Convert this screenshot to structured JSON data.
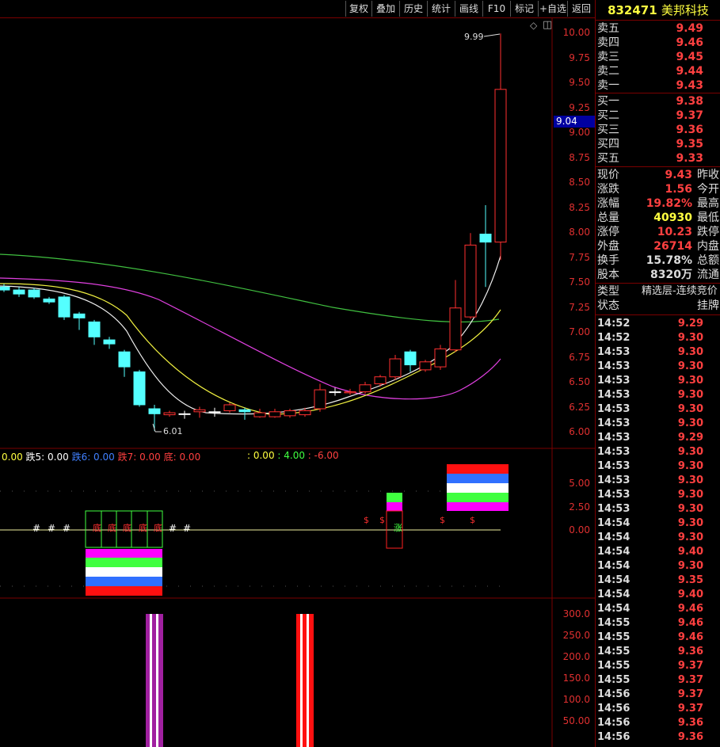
{
  "toolbar": {
    "buttons": [
      "复权",
      "叠加",
      "历史",
      "统计",
      "画线",
      "F10",
      "标记",
      "+自选",
      "返回"
    ]
  },
  "stock": {
    "code": "832471",
    "name": "美邦科技"
  },
  "main_chart": {
    "y_ticks": [
      "10.00",
      "9.75",
      "9.50",
      "9.25",
      "9.00",
      "8.75",
      "8.50",
      "8.25",
      "8.00",
      "7.75",
      "7.50",
      "7.25",
      "7.00",
      "6.75",
      "6.50",
      "6.25",
      "6.00"
    ],
    "high_label": "9.99",
    "low_label": "6.01",
    "cursor_price": "9.04",
    "markers": [
      "◇",
      "◫"
    ]
  },
  "indicator": {
    "labels": [
      {
        "text": "0.00",
        "color": "#ffff40"
      },
      {
        "text": " 跌5: 0.00",
        "color": "#ffffff"
      },
      {
        "text": " 跌6: 0.00",
        "color": "#4080ff"
      },
      {
        "text": " 跌7: 0.00",
        "color": "#ff4040"
      },
      {
        "text": " 底: 0.00",
        "color": "#ff4040"
      }
    ],
    "labels2": [
      {
        "text": ": 0.00",
        "color": "#ffff40"
      },
      {
        "text": " : 4.00",
        "color": "#40ff40"
      },
      {
        "text": " : -6.00",
        "color": "#ff4040"
      }
    ],
    "y_ticks": [
      "5.00",
      "2.50",
      "0.00"
    ],
    "hash": "#",
    "di": "底",
    "dollar": "$",
    "zhang": "涨"
  },
  "volume_panel": {
    "y_ticks": [
      "300.0",
      "250.0",
      "200.0",
      "150.0",
      "100.0",
      "50.00"
    ]
  },
  "quote": {
    "sell": [
      {
        "label": "卖五",
        "price": "9.49"
      },
      {
        "label": "卖四",
        "price": "9.46"
      },
      {
        "label": "卖三",
        "price": "9.45"
      },
      {
        "label": "卖二",
        "price": "9.44"
      },
      {
        "label": "卖一",
        "price": "9.43"
      }
    ],
    "buy": [
      {
        "label": "买一",
        "price": "9.38"
      },
      {
        "label": "买二",
        "price": "9.37"
      },
      {
        "label": "买三",
        "price": "9.36"
      },
      {
        "label": "买四",
        "price": "9.35"
      },
      {
        "label": "买五",
        "price": "9.33"
      }
    ],
    "stats": [
      {
        "label": "现价",
        "value": "9.43",
        "label2": "昨收",
        "color": "#ff4040"
      },
      {
        "label": "涨跌",
        "value": "1.56",
        "label2": "今开",
        "color": "#ff4040"
      },
      {
        "label": "涨幅",
        "value": "19.82%",
        "label2": "最高",
        "color": "#ff4040"
      },
      {
        "label": "总量",
        "value": "40930",
        "label2": "最低",
        "color": "#ffff40"
      },
      {
        "label": "涨停",
        "value": "10.23",
        "label2": "跌停",
        "color": "#ff4040"
      },
      {
        "label": "外盘",
        "value": "26714",
        "label2": "内盘",
        "color": "#ff4040"
      },
      {
        "label": "换手",
        "value": "15.78%",
        "label2": "总额",
        "color": "#dddddd"
      },
      {
        "label": "股本",
        "value": "8320万",
        "label2": "流通",
        "color": "#dddddd"
      }
    ],
    "type_label": "类型",
    "type_value": "精选层-连续竞价",
    "status_label": "状态",
    "status_value": "挂牌"
  },
  "ticks": [
    {
      "t": "14:52",
      "p": "9.29"
    },
    {
      "t": "14:52",
      "p": "9.30"
    },
    {
      "t": "14:53",
      "p": "9.30"
    },
    {
      "t": "14:53",
      "p": "9.30"
    },
    {
      "t": "14:53",
      "p": "9.30"
    },
    {
      "t": "14:53",
      "p": "9.30"
    },
    {
      "t": "14:53",
      "p": "9.30"
    },
    {
      "t": "14:53",
      "p": "9.30"
    },
    {
      "t": "14:53",
      "p": "9.29"
    },
    {
      "t": "14:53",
      "p": "9.30"
    },
    {
      "t": "14:53",
      "p": "9.30"
    },
    {
      "t": "14:53",
      "p": "9.30"
    },
    {
      "t": "14:53",
      "p": "9.30"
    },
    {
      "t": "14:53",
      "p": "9.30"
    },
    {
      "t": "14:54",
      "p": "9.30"
    },
    {
      "t": "14:54",
      "p": "9.30"
    },
    {
      "t": "14:54",
      "p": "9.40"
    },
    {
      "t": "14:54",
      "p": "9.30"
    },
    {
      "t": "14:54",
      "p": "9.35"
    },
    {
      "t": "14:54",
      "p": "9.40"
    },
    {
      "t": "14:54",
      "p": "9.46"
    },
    {
      "t": "14:55",
      "p": "9.46"
    },
    {
      "t": "14:55",
      "p": "9.46"
    },
    {
      "t": "14:55",
      "p": "9.36"
    },
    {
      "t": "14:55",
      "p": "9.37"
    },
    {
      "t": "14:55",
      "p": "9.37"
    },
    {
      "t": "14:56",
      "p": "9.37"
    },
    {
      "t": "14:56",
      "p": "9.37"
    },
    {
      "t": "14:56",
      "p": "9.36"
    },
    {
      "t": "14:56",
      "p": "9.36"
    }
  ],
  "candles": [
    {
      "o": 7.45,
      "c": 7.42,
      "h": 7.48,
      "l": 7.4
    },
    {
      "o": 7.42,
      "c": 7.38,
      "h": 7.45,
      "l": 7.35
    },
    {
      "o": 7.42,
      "c": 7.35,
      "h": 7.44,
      "l": 7.33
    },
    {
      "o": 7.33,
      "c": 7.3,
      "h": 7.35,
      "l": 7.28
    },
    {
      "o": 7.35,
      "c": 7.15,
      "h": 7.37,
      "l": 7.12
    },
    {
      "o": 7.18,
      "c": 7.14,
      "h": 7.2,
      "l": 7.02
    },
    {
      "o": 7.1,
      "c": 6.95,
      "h": 7.12,
      "l": 6.87
    },
    {
      "o": 6.92,
      "c": 6.88,
      "h": 6.95,
      "l": 6.83
    },
    {
      "o": 6.8,
      "c": 6.65,
      "h": 6.82,
      "l": 6.55
    },
    {
      "o": 6.6,
      "c": 6.27,
      "h": 6.62,
      "l": 6.25
    },
    {
      "o": 6.23,
      "c": 6.18,
      "h": 6.27,
      "l": 6.01
    },
    {
      "o": 6.17,
      "c": 6.19,
      "h": 6.21,
      "l": 6.15
    },
    {
      "o": 6.18,
      "c": 6.18,
      "h": 6.21,
      "l": 6.13
    },
    {
      "o": 6.2,
      "c": 6.22,
      "h": 6.25,
      "l": 6.14
    },
    {
      "o": 6.2,
      "c": 6.2,
      "h": 6.24,
      "l": 6.15
    },
    {
      "o": 6.21,
      "c": 6.27,
      "h": 6.29,
      "l": 6.19
    },
    {
      "o": 6.22,
      "c": 6.2,
      "h": 6.24,
      "l": 6.12
    },
    {
      "o": 6.15,
      "c": 6.19,
      "h": 6.23,
      "l": 6.14
    },
    {
      "o": 6.15,
      "c": 6.2,
      "h": 6.23,
      "l": 6.14
    },
    {
      "o": 6.16,
      "c": 6.21,
      "h": 6.23,
      "l": 6.14
    },
    {
      "o": 6.17,
      "c": 6.21,
      "h": 6.24,
      "l": 6.15
    },
    {
      "o": 6.23,
      "c": 6.42,
      "h": 6.48,
      "l": 6.2
    },
    {
      "o": 6.4,
      "c": 6.4,
      "h": 6.44,
      "l": 6.36
    },
    {
      "o": 6.39,
      "c": 6.4,
      "h": 6.43,
      "l": 6.37
    },
    {
      "o": 6.4,
      "c": 6.47,
      "h": 6.5,
      "l": 6.38
    },
    {
      "o": 6.48,
      "c": 6.55,
      "h": 6.57,
      "l": 6.45
    },
    {
      "o": 6.55,
      "c": 6.73,
      "h": 6.77,
      "l": 6.52
    },
    {
      "o": 6.8,
      "c": 6.67,
      "h": 6.82,
      "l": 6.6
    },
    {
      "o": 6.62,
      "c": 6.7,
      "h": 6.72,
      "l": 6.6
    },
    {
      "o": 6.65,
      "c": 6.83,
      "h": 6.87,
      "l": 6.62
    },
    {
      "o": 6.82,
      "c": 7.24,
      "h": 7.52,
      "l": 6.8
    },
    {
      "o": 7.15,
      "c": 7.87,
      "h": 7.99,
      "l": 7.13
    },
    {
      "o": 7.98,
      "c": 7.9,
      "h": 8.27,
      "l": 7.45
    },
    {
      "o": 7.9,
      "c": 9.43,
      "h": 9.99,
      "l": 7.72
    }
  ]
}
